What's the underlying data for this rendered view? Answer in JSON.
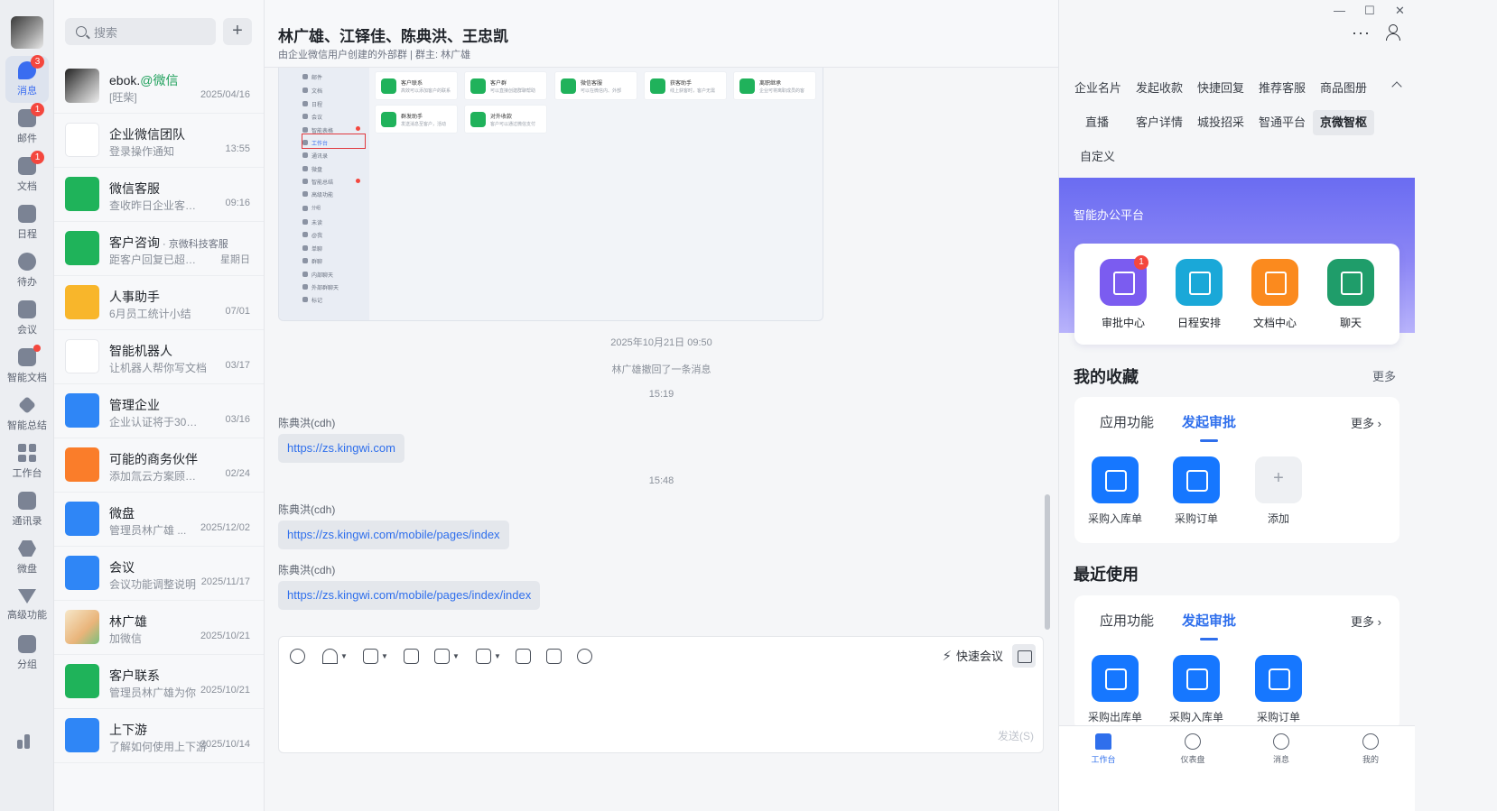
{
  "rail": {
    "items": [
      {
        "label": "消息",
        "badge": "3"
      },
      {
        "label": "邮件",
        "badge": "1"
      },
      {
        "label": "文档",
        "badge": "1"
      },
      {
        "label": "日程",
        "badge": ""
      },
      {
        "label": "待办",
        "badge": ""
      },
      {
        "label": "会议",
        "badge": ""
      },
      {
        "label": "智能文档",
        "badge": ""
      },
      {
        "label": "智能总结",
        "badge": ""
      },
      {
        "label": "工作台",
        "badge": ""
      },
      {
        "label": "通讯录",
        "badge": ""
      },
      {
        "label": "微盘",
        "badge": ""
      },
      {
        "label": "高级功能",
        "badge": ""
      },
      {
        "label": "分组",
        "badge": ""
      }
    ]
  },
  "search": {
    "placeholder": "搜索",
    "add": "+"
  },
  "conversations": [
    {
      "name": "ebok.",
      "tag": "@微信",
      "preview": "[旺柴]",
      "time": "2025/04/16"
    },
    {
      "name": "企业微信团队",
      "preview": "登录操作通知",
      "time": "13:55"
    },
    {
      "name": "微信客服",
      "preview": "查收昨日企业客服数据",
      "time": "09:16"
    },
    {
      "name": "客户咨询",
      "sub": " · 京微科技客服",
      "preview": "距客户回复已超过48小时",
      "time": "星期日"
    },
    {
      "name": "人事助手",
      "preview": "6月员工统计小结",
      "time": "07/01"
    },
    {
      "name": "智能机器人",
      "preview": "让机器人帮你写文档",
      "time": "03/17"
    },
    {
      "name": "管理企业",
      "preview": "企业认证将于30天后到期",
      "time": "03/16"
    },
    {
      "name": "可能的商务伙伴",
      "preview": "添加氚云方案顾问_智能",
      "time": "02/24"
    },
    {
      "name": "微盘",
      "preview": "管理员林广雄 ...",
      "time": "2025/12/02"
    },
    {
      "name": "会议",
      "preview": "会议功能调整说明",
      "time": "2025/11/17"
    },
    {
      "name": "林广雄",
      "preview": "加微信",
      "time": "2025/10/21"
    },
    {
      "name": "客户联系",
      "preview": "管理员林广雄为你",
      "time": "2025/10/21"
    },
    {
      "name": "上下游",
      "preview": "了解如何使用上下游",
      "time": "2025/10/14"
    }
  ],
  "chat": {
    "title": "林广雄、江铎佳、陈典洪、王忠凯",
    "subtitle": "由企业微信用户创建的外部群 | 群主: 林广雄",
    "screenshot": {
      "side_items": [
        "邮件",
        "文档",
        "日程",
        "会议",
        "智能表格",
        "工作台",
        "通讯录",
        "微盘",
        "智能总结",
        "高级功能",
        "分组",
        "未读",
        "@我",
        "单聊",
        "群聊",
        "内部聊天",
        "外部群聊天",
        "标记"
      ],
      "cards": [
        {
          "title": "客户联系",
          "desc": "高效可以添加客户的联系"
        },
        {
          "title": "客户群",
          "desc": "可以直接创建群聊帮助"
        },
        {
          "title": "微信客服",
          "desc": "可以在微信内、外部"
        },
        {
          "title": "获客助手",
          "desc": "线上获客时，客户无需"
        },
        {
          "title": "离职继承",
          "desc": "企业可将离职成员的客"
        },
        {
          "title": "群发助手",
          "desc": "发送消息至客户，活动"
        },
        {
          "title": "对外收款",
          "desc": "客户可以通过微信支付"
        }
      ]
    },
    "time1": "2025年10月21日 09:50",
    "recall": "林广雄撤回了一条消息",
    "time2": "15:19",
    "time3": "15:48",
    "messages": [
      {
        "sender": "陈典洪(cdh)",
        "text": "https://zs.kingwi.com"
      },
      {
        "sender": "陈典洪(cdh)",
        "text": "https://zs.kingwi.com/mobile/pages/index"
      },
      {
        "sender": "陈典洪(cdh)",
        "text": "https://zs.kingwi.com/mobile/pages/index/index"
      }
    ],
    "composer": {
      "quick_meeting": "快速会议",
      "send": "发送(S)"
    }
  },
  "right": {
    "window": {
      "min": "—",
      "max": "☐",
      "close": "✕"
    },
    "more": "···",
    "tabs_row1": [
      "企业名片",
      "发起收款",
      "快捷回复",
      "推荐客服",
      "商品图册"
    ],
    "tabs_row2": [
      "直播",
      "客户详情",
      "城投招采",
      "智通平台",
      "京微智枢"
    ],
    "tabs_row3": [
      "自定义"
    ],
    "hero_title": "智能办公平台",
    "hero_apps": [
      {
        "label": "审批中心",
        "badge": "1",
        "color": "#7b5cf0"
      },
      {
        "label": "日程安排",
        "badge": "",
        "color": "#1aa8d8"
      },
      {
        "label": "文档中心",
        "badge": "",
        "color": "#fb8a1e"
      },
      {
        "label": "聊天",
        "badge": "",
        "color": "#1f9d6a"
      }
    ],
    "fav": {
      "title": "我的收藏",
      "more": "更多",
      "tabs": [
        "应用功能",
        "发起审批"
      ],
      "card_more": "更多 ›",
      "apps": [
        "采购入库单",
        "采购订单",
        "添加"
      ]
    },
    "recent": {
      "title": "最近使用",
      "tabs": [
        "应用功能",
        "发起审批"
      ],
      "card_more": "更多 ›",
      "apps": [
        "采购出库单",
        "采购入库单",
        "采购订单"
      ]
    },
    "bottom_nav": [
      "工作台",
      "仪表盘",
      "消息",
      "我的"
    ]
  }
}
